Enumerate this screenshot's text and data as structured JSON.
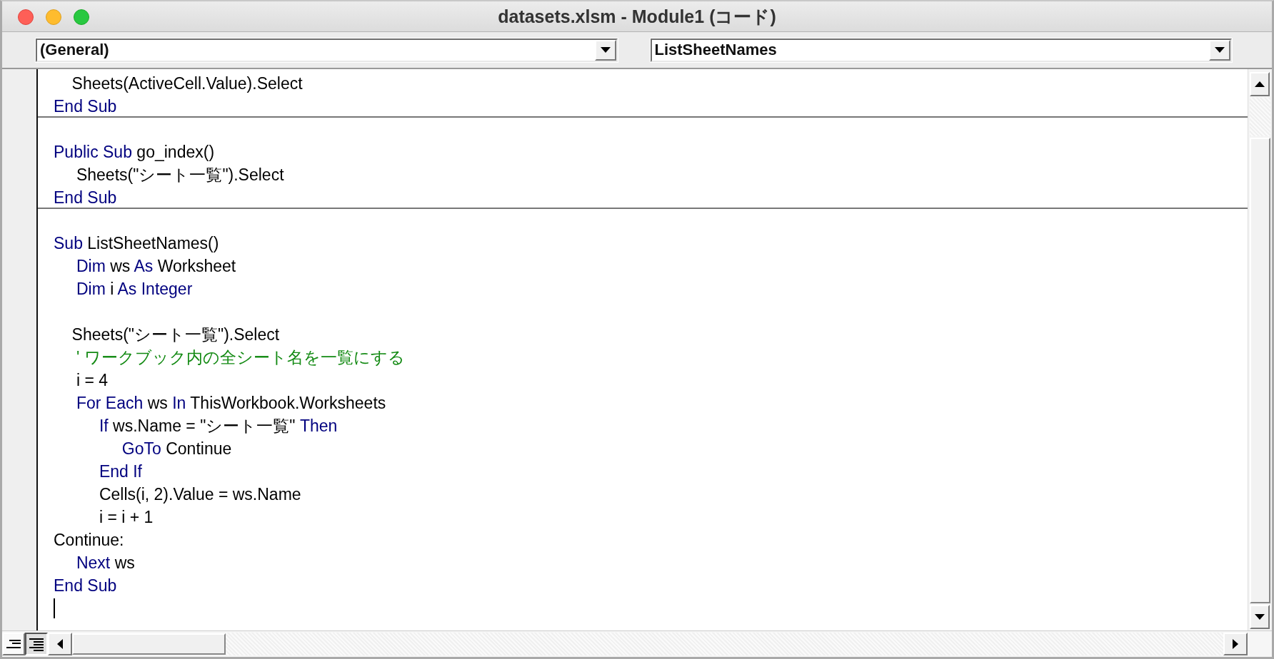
{
  "window": {
    "title": "datasets.xlsm - Module1 (コード)"
  },
  "object_dropdown": {
    "value": "(General)"
  },
  "procedure_dropdown": {
    "value": "ListSheetNames"
  },
  "code_lines": [
    {
      "segments": [
        {
          "kind": "plain",
          "text": "    Sheets(ActiveCell.Value).Select"
        }
      ],
      "separator_after": false
    },
    {
      "segments": [
        {
          "kind": "keyword",
          "text": "End Sub"
        }
      ],
      "separator_after": true
    },
    {
      "separator_after": false
    },
    {
      "segments": [
        {
          "kind": "keyword",
          "text": "Public Sub"
        },
        {
          "kind": "plain",
          "text": " go_index()"
        }
      ],
      "separator_after": false
    },
    {
      "segments": [
        {
          "kind": "plain",
          "text": "     Sheets(\"シート一覧\").Select"
        }
      ],
      "separator_after": false
    },
    {
      "segments": [
        {
          "kind": "keyword",
          "text": "End Sub"
        }
      ],
      "separator_after": true
    },
    {
      "separator_after": false
    },
    {
      "segments": [
        {
          "kind": "keyword",
          "text": "Sub"
        },
        {
          "kind": "plain",
          "text": " ListSheetNames()"
        }
      ],
      "separator_after": false
    },
    {
      "segments": [
        {
          "kind": "keyword",
          "text": "     Dim"
        },
        {
          "kind": "plain",
          "text": " ws "
        },
        {
          "kind": "keyword",
          "text": "As"
        },
        {
          "kind": "plain",
          "text": " Worksheet"
        }
      ],
      "separator_after": false
    },
    {
      "segments": [
        {
          "kind": "keyword",
          "text": "     Dim"
        },
        {
          "kind": "plain",
          "text": " i "
        },
        {
          "kind": "keyword",
          "text": "As Integer"
        }
      ],
      "separator_after": false
    },
    {
      "separator_after": false
    },
    {
      "segments": [
        {
          "kind": "plain",
          "text": "    Sheets(\"シート一覧\").Select"
        }
      ],
      "separator_after": false
    },
    {
      "segments": [
        {
          "kind": "comment",
          "text": "     ' ワークブック内の全シート名を一覧にする"
        }
      ],
      "separator_after": false
    },
    {
      "segments": [
        {
          "kind": "plain",
          "text": "     i = 4"
        }
      ],
      "separator_after": false
    },
    {
      "segments": [
        {
          "kind": "keyword",
          "text": "     For Each"
        },
        {
          "kind": "plain",
          "text": " ws "
        },
        {
          "kind": "keyword",
          "text": "In"
        },
        {
          "kind": "plain",
          "text": " ThisWorkbook.Worksheets"
        }
      ],
      "separator_after": false
    },
    {
      "segments": [
        {
          "kind": "keyword",
          "text": "          If"
        },
        {
          "kind": "plain",
          "text": " ws.Name = \"シート一覧\" "
        },
        {
          "kind": "keyword",
          "text": "Then"
        }
      ],
      "separator_after": false
    },
    {
      "segments": [
        {
          "kind": "keyword",
          "text": "               GoTo"
        },
        {
          "kind": "plain",
          "text": " Continue"
        }
      ],
      "separator_after": false
    },
    {
      "segments": [
        {
          "kind": "keyword",
          "text": "          End If"
        }
      ],
      "separator_after": false
    },
    {
      "segments": [
        {
          "kind": "plain",
          "text": "          Cells(i, 2).Value = ws.Name"
        }
      ],
      "separator_after": false
    },
    {
      "segments": [
        {
          "kind": "plain",
          "text": "          i = i + 1"
        }
      ],
      "separator_after": false
    },
    {
      "segments": [
        {
          "kind": "plain",
          "text": "Continue:"
        }
      ],
      "separator_after": false
    },
    {
      "segments": [
        {
          "kind": "keyword",
          "text": "     Next"
        },
        {
          "kind": "plain",
          "text": " ws"
        }
      ],
      "separator_after": false
    },
    {
      "segments": [
        {
          "kind": "keyword",
          "text": "End Sub"
        }
      ],
      "separator_after": false
    }
  ],
  "text_cursor": true,
  "view_buttons": [
    {
      "kind": "procedure",
      "selected": false
    },
    {
      "kind": "module",
      "selected": true
    }
  ]
}
